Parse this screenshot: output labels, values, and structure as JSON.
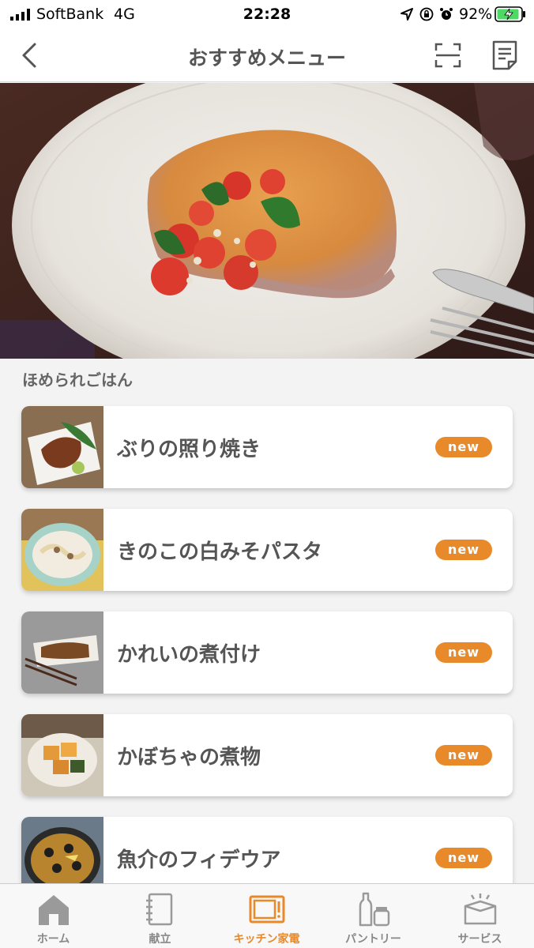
{
  "status_bar": {
    "carrier": "SoftBank",
    "network": "4G",
    "time": "22:28",
    "battery": "92%"
  },
  "nav": {
    "title": "おすすめメニュー"
  },
  "section": {
    "title": "ほめられごはん"
  },
  "menu_items": [
    {
      "title": "ぶりの照り焼き",
      "badge": "new"
    },
    {
      "title": "きのこの白みそパスタ",
      "badge": "new"
    },
    {
      "title": "かれいの煮付け",
      "badge": "new"
    },
    {
      "title": "かぼちゃの煮物",
      "badge": "new"
    },
    {
      "title": "魚介のフィデウア",
      "badge": "new"
    }
  ],
  "tabs": [
    {
      "label": "ホーム",
      "icon": "home-icon"
    },
    {
      "label": "献立",
      "icon": "notebook-icon"
    },
    {
      "label": "キッチン家電",
      "icon": "microwave-icon"
    },
    {
      "label": "パントリー",
      "icon": "pantry-icon"
    },
    {
      "label": "サービス",
      "icon": "gift-box-icon"
    }
  ],
  "colors": {
    "accent": "#e8892a",
    "text": "#555555",
    "background": "#f3f3f3"
  }
}
